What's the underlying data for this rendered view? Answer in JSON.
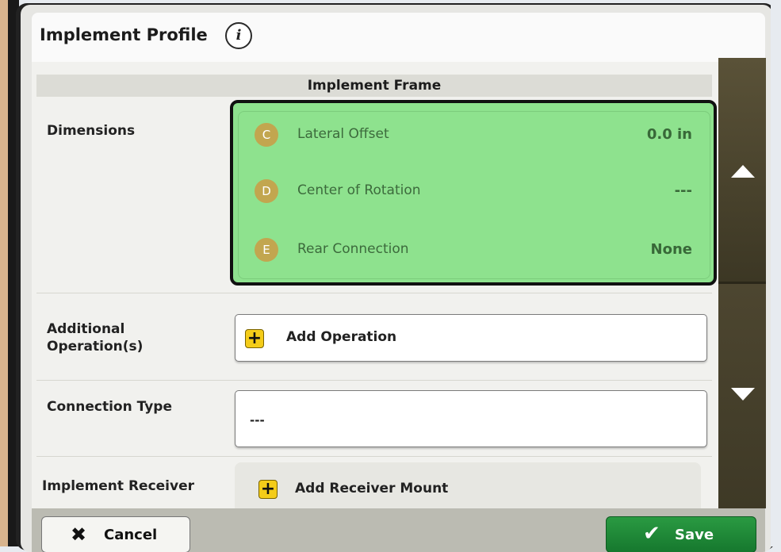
{
  "window": {
    "title": "Implement Profile",
    "info_icon": "info-icon",
    "info_glyph": "i"
  },
  "section": {
    "header": "Implement Frame"
  },
  "rows": {
    "dimensions_label": "Dimensions",
    "additional_label": "Additional\nOperation(s)",
    "connection_label": "Connection Type",
    "receiver_label": "Implement Receiver"
  },
  "dimensions": [
    {
      "letter": "C",
      "label": "Lateral Offset",
      "value": "0.0 in"
    },
    {
      "letter": "D",
      "label": "Center of Rotation",
      "value": "---"
    },
    {
      "letter": "E",
      "label": "Rear Connection",
      "value": "None"
    }
  ],
  "fields": {
    "add_operation_label": "Add Operation",
    "connection_type_value": "---",
    "add_receiver_label": "Add Receiver Mount",
    "plus_glyph": "+"
  },
  "scroll": {
    "up_icon": "triangle-up-icon",
    "down_icon": "triangle-down-icon"
  },
  "buttons": {
    "cancel_label": "Cancel",
    "cancel_icon": "x-icon",
    "cancel_glyph": "✖",
    "save_label": "Save",
    "save_icon": "check-icon",
    "save_glyph": "✔"
  },
  "colors": {
    "dimensions_highlight": "#8ee28e",
    "letter_badge": "#c2a64f",
    "plus_badge": "#f4cc19",
    "save_button": "#1f8a38",
    "scrollbar": "#4a4430"
  }
}
